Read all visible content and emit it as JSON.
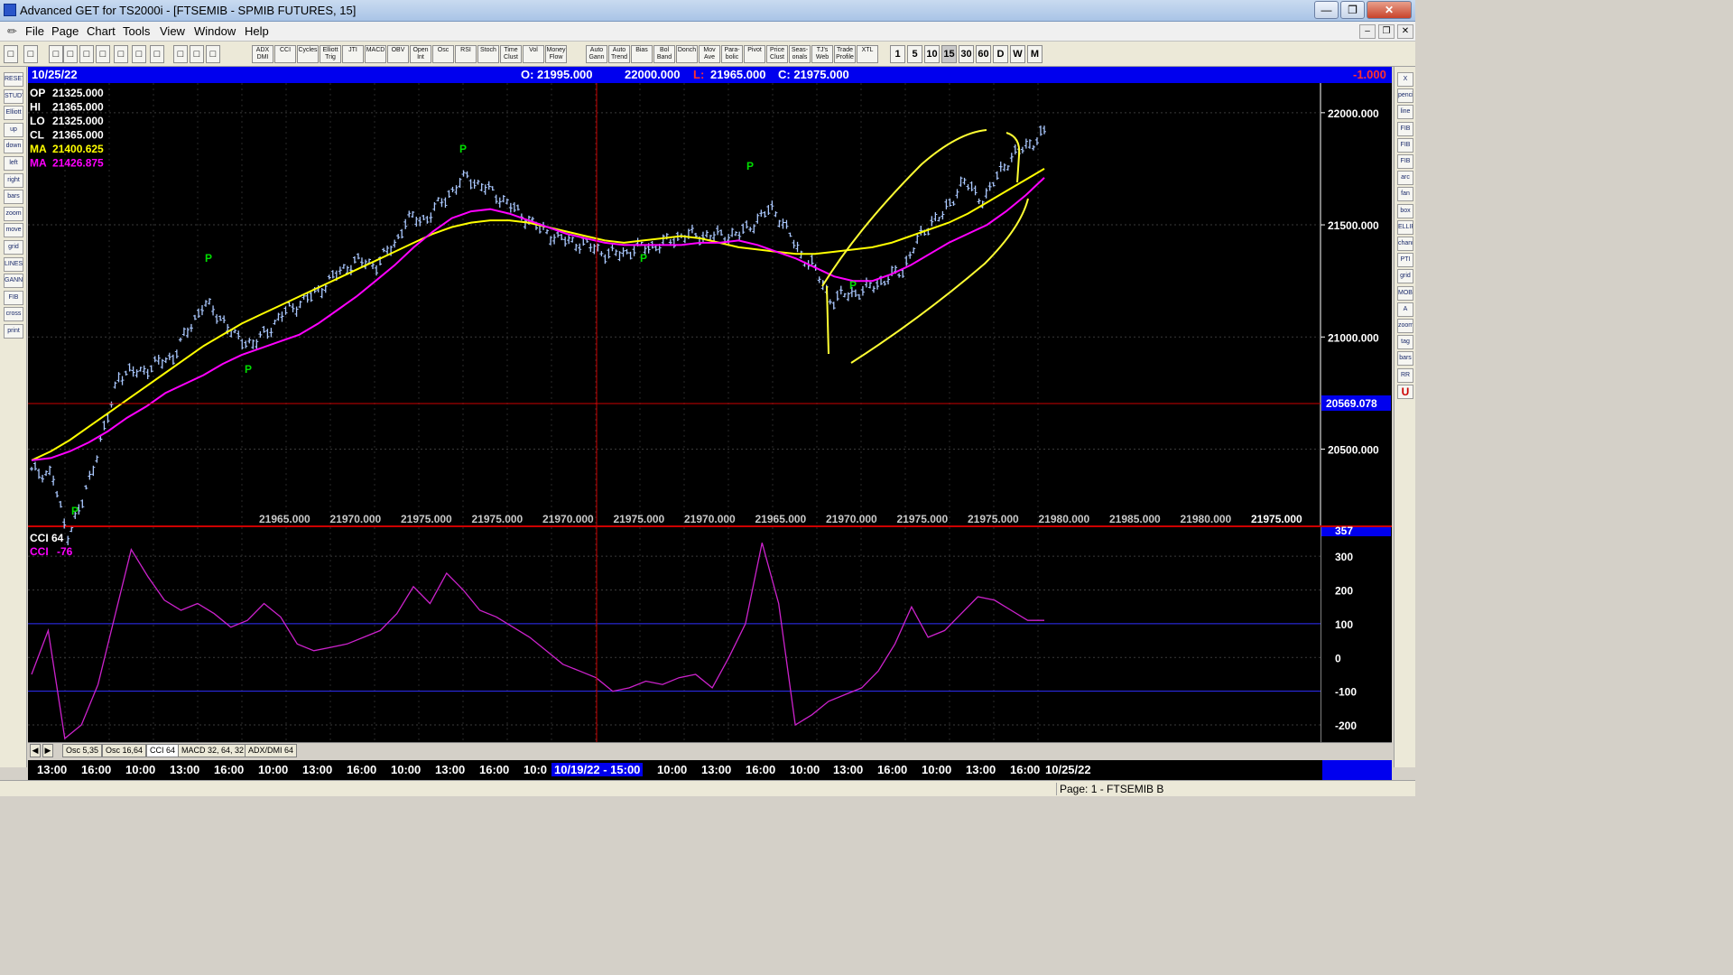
{
  "window": {
    "title": "Advanced GET for TS2000i - [FTSEMIB - SPMIB FUTURES, 15]"
  },
  "menu": [
    "File",
    "Page",
    "Chart",
    "Tools",
    "View",
    "Window",
    "Help"
  ],
  "toolbar": {
    "studies": [
      "ADX DMI",
      "CCI",
      "Cycles",
      "Elliott Trig",
      "JTI",
      "MACD",
      "OBV",
      "Open Int",
      "Osc",
      "RSI",
      "Stoch",
      "Time Clust",
      "Vol",
      "Money Flow",
      "Auto Gann",
      "Auto Trend",
      "Bias",
      "Bol Band",
      "Donch",
      "Mov Ave",
      "Para-bolic",
      "Pivot",
      "Price Clust",
      "Seas-onals",
      "TJ's Web",
      "Trade Profile",
      "XTL"
    ],
    "periods": [
      "1",
      "5",
      "10",
      "15",
      "30",
      "60",
      "D",
      "W",
      "M"
    ]
  },
  "left_tools": [
    "RESET",
    "STUDY",
    "Elliott",
    "up",
    "down",
    "left",
    "right",
    "bars",
    "zoom",
    "move",
    "grid",
    "LINES",
    "GANN",
    "FIB",
    "cross",
    "print"
  ],
  "right_tools": [
    "X",
    "pencil",
    "line",
    "FIB RET",
    "FIB EXT",
    "FIB TIME",
    "arc",
    "fan",
    "box",
    "ELLIPS",
    "channel",
    "PTI",
    "grid",
    "MOB",
    "A",
    "zoom",
    "tag",
    "bars",
    "RR",
    "U"
  ],
  "infobar": {
    "date": "10/25/22",
    "open": "O: 21995.000",
    "high": "22000.000",
    "low_label": "L:",
    "low": "21965.000",
    "close": "C: 21975.000",
    "change": "-1.000"
  },
  "price_panel": {
    "readouts": [
      {
        "label": "OP",
        "value": "21325.000",
        "color": "#ffffff"
      },
      {
        "label": "HI",
        "value": "21365.000",
        "color": "#ffffff"
      },
      {
        "label": "LO",
        "value": "21325.000",
        "color": "#ffffff"
      },
      {
        "label": "CL",
        "value": "21365.000",
        "color": "#ffffff"
      },
      {
        "label": "MA",
        "value": "21400.625",
        "color": "#ffff00"
      },
      {
        "label": "MA",
        "value": "21426.875",
        "color": "#ff00ff"
      }
    ],
    "y_ticks": [
      "22000.000",
      "21500.000",
      "21000.000",
      "20500.000"
    ],
    "cursor_price": "20569.078",
    "bottom_values": [
      "21965.000",
      "21970.000",
      "21975.000",
      "21975.000",
      "21970.000",
      "21975.000",
      "21970.000",
      "21965.000",
      "21970.000",
      "21975.000",
      "21975.000",
      "21980.000",
      "21985.000",
      "21980.000",
      "21975.000"
    ],
    "pivot_label": "P"
  },
  "cci_panel": {
    "readouts": [
      {
        "label": "CCI 64",
        "value": "",
        "color": "#ffffff"
      },
      {
        "label": "CCI",
        "value": "-76",
        "color": "#ff00ff"
      }
    ],
    "y_ticks": [
      "357",
      "300",
      "200",
      "100",
      "0",
      "-100",
      "-200"
    ]
  },
  "tabs": [
    "Osc 5,35",
    "Osc 16,64",
    "CCI 64",
    "MACD 32, 64, 32",
    "ADX/DMI 64"
  ],
  "time_axis": [
    "13:00",
    "16:00",
    "10:00",
    "13:00",
    "16:00",
    "10:00",
    "13:00",
    "16:00",
    "10:00",
    "13:00",
    "16:00",
    "10:0",
    "10/19/22 - 15:00",
    "10:00",
    "13:00",
    "16:00",
    "10:00",
    "13:00",
    "16:00",
    "10:00",
    "13:00",
    "16:00",
    "10/25/22"
  ],
  "status": {
    "page": "Page: 1 - FTSEMIB B"
  },
  "colors": {
    "background": "#000000",
    "bars": "#aac8ff",
    "ma_fast": "#ffff00",
    "ma_slow": "#ff00ff",
    "cci": "#cc22cc",
    "pivot": "#00dd00",
    "cursor": "#cc0000",
    "infobar": "#0000ee"
  },
  "chart_data": [
    {
      "type": "ohlc",
      "symbol": "FTSEMIB - SPMIB FUTURES",
      "interval": "15",
      "ylim": [
        20200,
        22100
      ],
      "series": [
        {
          "name": "MA",
          "values": [
            20450,
            20490,
            20540,
            20600,
            20660,
            20720,
            20780,
            20840,
            20900,
            20960,
            21010,
            21060,
            21100,
            21140,
            21180,
            21220,
            21260,
            21300,
            21340,
            21380,
            21420,
            21460,
            21490,
            21510,
            21520,
            21520,
            21510,
            21490,
            21470,
            21450,
            21430,
            21420,
            21430,
            21440,
            21450,
            21440,
            21420,
            21400,
            21390,
            21380,
            21370,
            21370,
            21380,
            21390,
            21400,
            21420,
            21450,
            21480,
            21510,
            21550,
            21600,
            21650,
            21700,
            21750
          ]
        },
        {
          "name": "MA",
          "values": [
            20450,
            20460,
            20490,
            20530,
            20580,
            20640,
            20690,
            20750,
            20790,
            20830,
            20880,
            20920,
            20950,
            20980,
            21010,
            21060,
            21120,
            21180,
            21250,
            21320,
            21400,
            21470,
            21530,
            21560,
            21570,
            21550,
            21520,
            21490,
            21460,
            21440,
            21420,
            21410,
            21410,
            21410,
            21410,
            21420,
            21420,
            21430,
            21410,
            21380,
            21350,
            21310,
            21270,
            21250,
            21250,
            21280,
            21320,
            21370,
            21420,
            21460,
            21500,
            21560,
            21630,
            21710
          ]
        }
      ]
    },
    {
      "type": "line",
      "ylim": [
        -240,
        370
      ],
      "series": [
        {
          "name": "CCI",
          "values": [
            -50,
            80,
            -240,
            -200,
            -80,
            120,
            320,
            240,
            170,
            140,
            160,
            130,
            90,
            110,
            160,
            120,
            40,
            20,
            30,
            40,
            60,
            80,
            130,
            210,
            160,
            250,
            200,
            140,
            120,
            90,
            60,
            20,
            -20,
            -40,
            -60,
            -100,
            -90,
            -70,
            -80,
            -60,
            -50,
            -90,
            0,
            100,
            340,
            160,
            -200,
            -170,
            -130,
            -110,
            -90,
            -40,
            40,
            150,
            60,
            80,
            130,
            180,
            170,
            140,
            110,
            110
          ]
        }
      ]
    }
  ]
}
